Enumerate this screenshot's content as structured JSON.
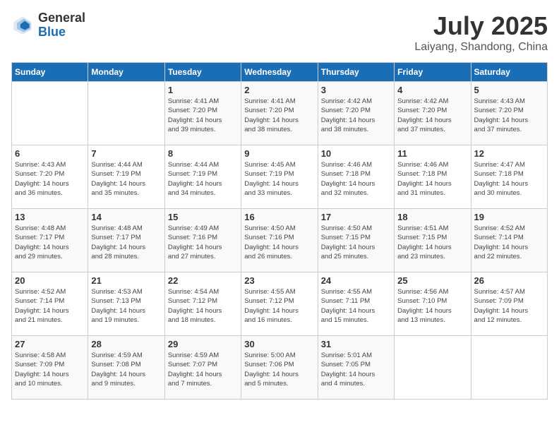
{
  "header": {
    "logo_general": "General",
    "logo_blue": "Blue",
    "month_title": "July 2025",
    "subtitle": "Laiyang, Shandong, China"
  },
  "days_of_week": [
    "Sunday",
    "Monday",
    "Tuesday",
    "Wednesday",
    "Thursday",
    "Friday",
    "Saturday"
  ],
  "weeks": [
    [
      {
        "day": "",
        "info": ""
      },
      {
        "day": "",
        "info": ""
      },
      {
        "day": "1",
        "info": "Sunrise: 4:41 AM\nSunset: 7:20 PM\nDaylight: 14 hours\nand 39 minutes."
      },
      {
        "day": "2",
        "info": "Sunrise: 4:41 AM\nSunset: 7:20 PM\nDaylight: 14 hours\nand 38 minutes."
      },
      {
        "day": "3",
        "info": "Sunrise: 4:42 AM\nSunset: 7:20 PM\nDaylight: 14 hours\nand 38 minutes."
      },
      {
        "day": "4",
        "info": "Sunrise: 4:42 AM\nSunset: 7:20 PM\nDaylight: 14 hours\nand 37 minutes."
      },
      {
        "day": "5",
        "info": "Sunrise: 4:43 AM\nSunset: 7:20 PM\nDaylight: 14 hours\nand 37 minutes."
      }
    ],
    [
      {
        "day": "6",
        "info": "Sunrise: 4:43 AM\nSunset: 7:20 PM\nDaylight: 14 hours\nand 36 minutes."
      },
      {
        "day": "7",
        "info": "Sunrise: 4:44 AM\nSunset: 7:19 PM\nDaylight: 14 hours\nand 35 minutes."
      },
      {
        "day": "8",
        "info": "Sunrise: 4:44 AM\nSunset: 7:19 PM\nDaylight: 14 hours\nand 34 minutes."
      },
      {
        "day": "9",
        "info": "Sunrise: 4:45 AM\nSunset: 7:19 PM\nDaylight: 14 hours\nand 33 minutes."
      },
      {
        "day": "10",
        "info": "Sunrise: 4:46 AM\nSunset: 7:18 PM\nDaylight: 14 hours\nand 32 minutes."
      },
      {
        "day": "11",
        "info": "Sunrise: 4:46 AM\nSunset: 7:18 PM\nDaylight: 14 hours\nand 31 minutes."
      },
      {
        "day": "12",
        "info": "Sunrise: 4:47 AM\nSunset: 7:18 PM\nDaylight: 14 hours\nand 30 minutes."
      }
    ],
    [
      {
        "day": "13",
        "info": "Sunrise: 4:48 AM\nSunset: 7:17 PM\nDaylight: 14 hours\nand 29 minutes."
      },
      {
        "day": "14",
        "info": "Sunrise: 4:48 AM\nSunset: 7:17 PM\nDaylight: 14 hours\nand 28 minutes."
      },
      {
        "day": "15",
        "info": "Sunrise: 4:49 AM\nSunset: 7:16 PM\nDaylight: 14 hours\nand 27 minutes."
      },
      {
        "day": "16",
        "info": "Sunrise: 4:50 AM\nSunset: 7:16 PM\nDaylight: 14 hours\nand 26 minutes."
      },
      {
        "day": "17",
        "info": "Sunrise: 4:50 AM\nSunset: 7:15 PM\nDaylight: 14 hours\nand 25 minutes."
      },
      {
        "day": "18",
        "info": "Sunrise: 4:51 AM\nSunset: 7:15 PM\nDaylight: 14 hours\nand 23 minutes."
      },
      {
        "day": "19",
        "info": "Sunrise: 4:52 AM\nSunset: 7:14 PM\nDaylight: 14 hours\nand 22 minutes."
      }
    ],
    [
      {
        "day": "20",
        "info": "Sunrise: 4:52 AM\nSunset: 7:14 PM\nDaylight: 14 hours\nand 21 minutes."
      },
      {
        "day": "21",
        "info": "Sunrise: 4:53 AM\nSunset: 7:13 PM\nDaylight: 14 hours\nand 19 minutes."
      },
      {
        "day": "22",
        "info": "Sunrise: 4:54 AM\nSunset: 7:12 PM\nDaylight: 14 hours\nand 18 minutes."
      },
      {
        "day": "23",
        "info": "Sunrise: 4:55 AM\nSunset: 7:12 PM\nDaylight: 14 hours\nand 16 minutes."
      },
      {
        "day": "24",
        "info": "Sunrise: 4:55 AM\nSunset: 7:11 PM\nDaylight: 14 hours\nand 15 minutes."
      },
      {
        "day": "25",
        "info": "Sunrise: 4:56 AM\nSunset: 7:10 PM\nDaylight: 14 hours\nand 13 minutes."
      },
      {
        "day": "26",
        "info": "Sunrise: 4:57 AM\nSunset: 7:09 PM\nDaylight: 14 hours\nand 12 minutes."
      }
    ],
    [
      {
        "day": "27",
        "info": "Sunrise: 4:58 AM\nSunset: 7:09 PM\nDaylight: 14 hours\nand 10 minutes."
      },
      {
        "day": "28",
        "info": "Sunrise: 4:59 AM\nSunset: 7:08 PM\nDaylight: 14 hours\nand 9 minutes."
      },
      {
        "day": "29",
        "info": "Sunrise: 4:59 AM\nSunset: 7:07 PM\nDaylight: 14 hours\nand 7 minutes."
      },
      {
        "day": "30",
        "info": "Sunrise: 5:00 AM\nSunset: 7:06 PM\nDaylight: 14 hours\nand 5 minutes."
      },
      {
        "day": "31",
        "info": "Sunrise: 5:01 AM\nSunset: 7:05 PM\nDaylight: 14 hours\nand 4 minutes."
      },
      {
        "day": "",
        "info": ""
      },
      {
        "day": "",
        "info": ""
      }
    ]
  ]
}
